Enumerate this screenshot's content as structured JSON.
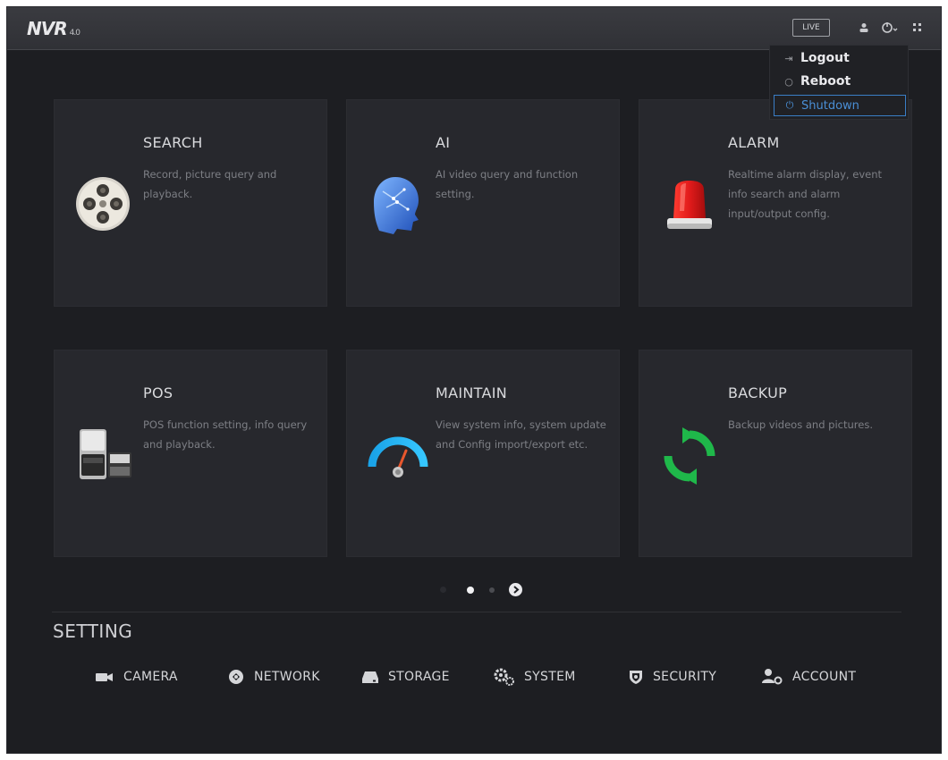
{
  "app": {
    "logo": "NVR",
    "logo_suffix": "4.0"
  },
  "topbar": {
    "live_label": "LIVE"
  },
  "dropdown": {
    "items": [
      {
        "label": "Logout",
        "glyph": "⇥"
      },
      {
        "label": "Reboot",
        "glyph": "○"
      },
      {
        "label": "Shutdown",
        "glyph": "⏻"
      }
    ]
  },
  "tiles": [
    {
      "title": "SEARCH",
      "desc": "Record, picture query and playback."
    },
    {
      "title": "AI",
      "desc": "AI video query and function setting."
    },
    {
      "title": "ALARM",
      "desc": "Realtime alarm display, event info search and alarm input/output config."
    },
    {
      "title": "POS",
      "desc": "POS function setting, info query and playback."
    },
    {
      "title": "MAINTAIN",
      "desc": "View system info, system update and Config import/export etc."
    },
    {
      "title": "BACKUP",
      "desc": "Backup videos and pictures."
    }
  ],
  "pager": {
    "current_page": 1,
    "page_count": 2
  },
  "setting": {
    "title": "SETTING",
    "items": [
      {
        "label": "CAMERA",
        "icon": "camera-icon"
      },
      {
        "label": "NETWORK",
        "icon": "network-icon"
      },
      {
        "label": "STORAGE",
        "icon": "storage-icon"
      },
      {
        "label": "SYSTEM",
        "icon": "system-icon"
      },
      {
        "label": "SECURITY",
        "icon": "security-icon"
      },
      {
        "label": "ACCOUNT",
        "icon": "account-icon"
      }
    ]
  },
  "colors": {
    "accent": "#3a7ec6",
    "background": "#1d1e22",
    "tile": "#27282d"
  }
}
